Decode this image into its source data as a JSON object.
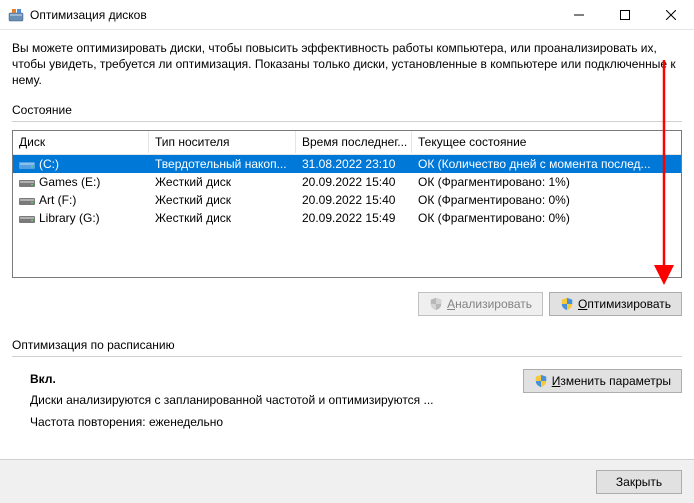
{
  "window": {
    "title": "Оптимизация дисков",
    "minimize": "—",
    "maximize": "□",
    "close": "✕"
  },
  "intro": "Вы можете оптимизировать диски, чтобы повысить эффективность работы компьютера, или проанализировать их, чтобы увидеть, требуется ли оптимизация. Показаны только диски, установленные в компьютере или подключенные к нему.",
  "stateLabel": "Состояние",
  "columns": {
    "disk": "Диск",
    "media": "Тип носителя",
    "last": "Время последнег...",
    "state": "Текущее состояние"
  },
  "rows": [
    {
      "name": "(C:)",
      "media": "Твердотельный накоп...",
      "last": "31.08.2022 23:10",
      "state": "ОК (Количество дней с момента послед...",
      "selected": true,
      "iconType": "ssd"
    },
    {
      "name": "Games (E:)",
      "media": "Жесткий диск",
      "last": "20.09.2022 15:40",
      "state": "ОК (Фрагментировано: 1%)",
      "selected": false,
      "iconType": "hdd"
    },
    {
      "name": "Art (F:)",
      "media": "Жесткий диск",
      "last": "20.09.2022 15:40",
      "state": "ОК (Фрагментировано: 0%)",
      "selected": false,
      "iconType": "hdd"
    },
    {
      "name": "Library (G:)",
      "media": "Жесткий диск",
      "last": "20.09.2022 15:49",
      "state": "ОК (Фрагментировано: 0%)",
      "selected": false,
      "iconType": "hdd"
    }
  ],
  "buttons": {
    "analyze": "Анализировать",
    "optimize": "Оптимизировать",
    "changeParams": "Изменить параметры",
    "close": "Закрыть"
  },
  "schedule": {
    "title": "Оптимизация по расписанию",
    "on": "Вкл.",
    "line1": "Диски анализируются с запланированной частотой и оптимизируются ...",
    "line2": "Частота повторения: еженедельно"
  }
}
